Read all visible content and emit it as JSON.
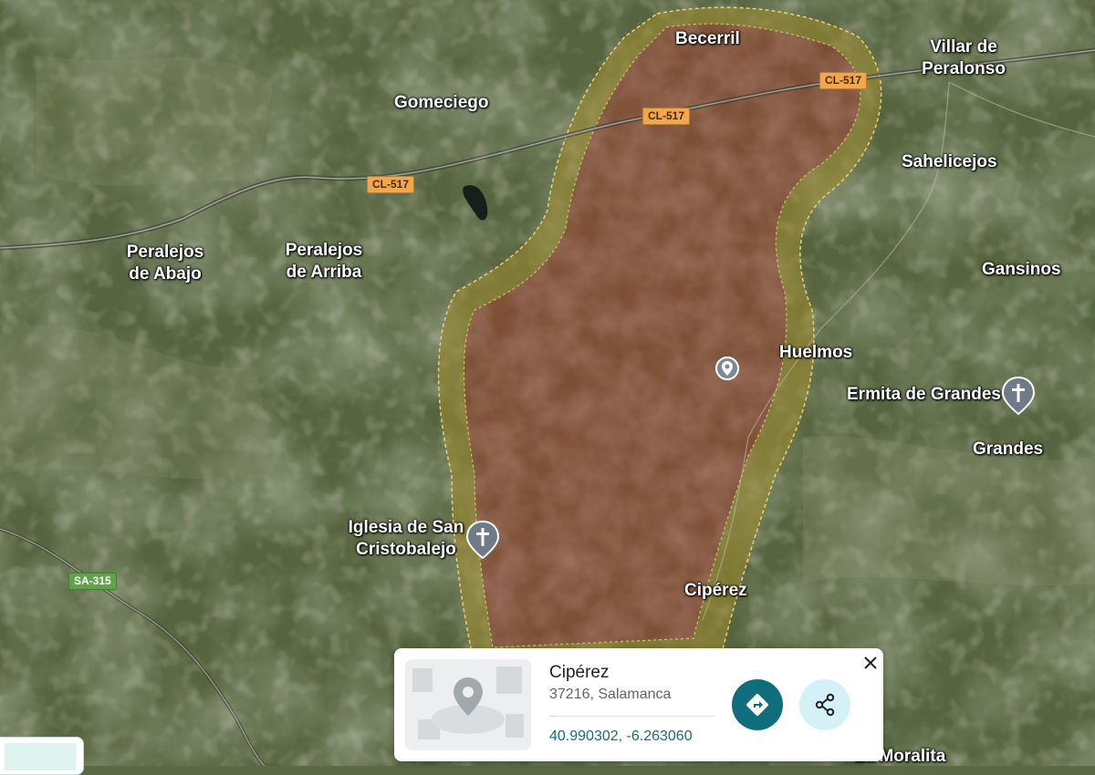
{
  "map": {
    "places": [
      {
        "id": "becerril",
        "label": "Becerril"
      },
      {
        "id": "villar-de-peralonso",
        "label": "Villar de\nPeralonso"
      },
      {
        "id": "gomeciego",
        "label": "Gomeciego"
      },
      {
        "id": "sahelicejos",
        "label": "Sahelicejos"
      },
      {
        "id": "peralejos-de-abajo",
        "label": "Peralejos\nde Abajo"
      },
      {
        "id": "peralejos-de-arriba",
        "label": "Peralejos\nde Arriba"
      },
      {
        "id": "gansinos",
        "label": "Gansinos"
      },
      {
        "id": "huelmos",
        "label": "Huelmos"
      },
      {
        "id": "ermita-de-grandes",
        "label": "Ermita de Grandes"
      },
      {
        "id": "grandes",
        "label": "Grandes"
      },
      {
        "id": "iglesia-de-san-cristobalejo",
        "label": "Iglesia de San\nCristobalejo"
      },
      {
        "id": "ciperez",
        "label": "Cipérez"
      },
      {
        "id": "la-moralita",
        "label": "La Moralita"
      }
    ],
    "roads": [
      {
        "id": "cl517-a",
        "label": "CL-517",
        "color": "#f2a74a"
      },
      {
        "id": "cl517-b",
        "label": "CL-517",
        "color": "#f2a74a"
      },
      {
        "id": "cl517-c",
        "label": "CL-517",
        "color": "#f2a74a"
      },
      {
        "id": "sa315",
        "label": "SA-315",
        "color": "#5fa34a"
      }
    ],
    "area": {
      "fill": "#7a3f34",
      "border": "#c9a93a"
    }
  },
  "card": {
    "name": "Cipérez",
    "address": "37216, Salamanca",
    "coordinates": "40.990302, -6.263060",
    "directions_icon": "directions-icon",
    "share_icon": "share-icon",
    "close_icon": "close-icon",
    "accent": "#106e7c"
  }
}
